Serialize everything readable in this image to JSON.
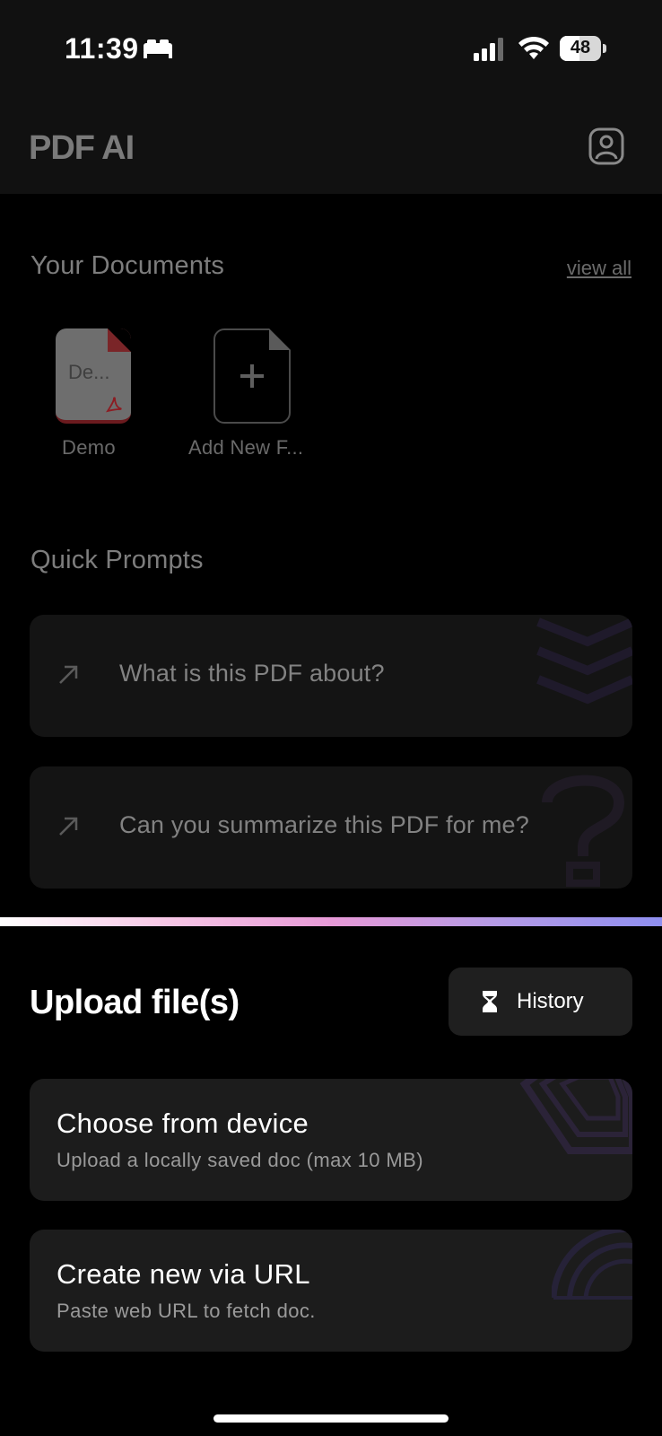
{
  "status_bar": {
    "time": "11:39",
    "battery": "48"
  },
  "header": {
    "title": "PDF AI"
  },
  "documents": {
    "title": "Your Documents",
    "view_all": "view all",
    "items": [
      {
        "thumb_text": "De...",
        "label": "Demo"
      },
      {
        "label": "Add New F..."
      }
    ]
  },
  "quick_prompts": {
    "title": "Quick Prompts",
    "items": [
      {
        "text": "What is this PDF about?"
      },
      {
        "text": "Can you summarize this PDF for me?"
      }
    ]
  },
  "upload_sheet": {
    "title": "Upload file(s)",
    "history_label": "History",
    "options": [
      {
        "title": "Choose from device",
        "subtitle": "Upload a locally saved doc (max 10 MB)"
      },
      {
        "title": "Create new via URL",
        "subtitle": "Paste web URL to fetch doc."
      }
    ]
  },
  "colors": {
    "background": "#000000",
    "card": "#1c1c1c",
    "gradient": [
      "#ffffff",
      "#e79ad7",
      "#8f8ff0"
    ]
  }
}
